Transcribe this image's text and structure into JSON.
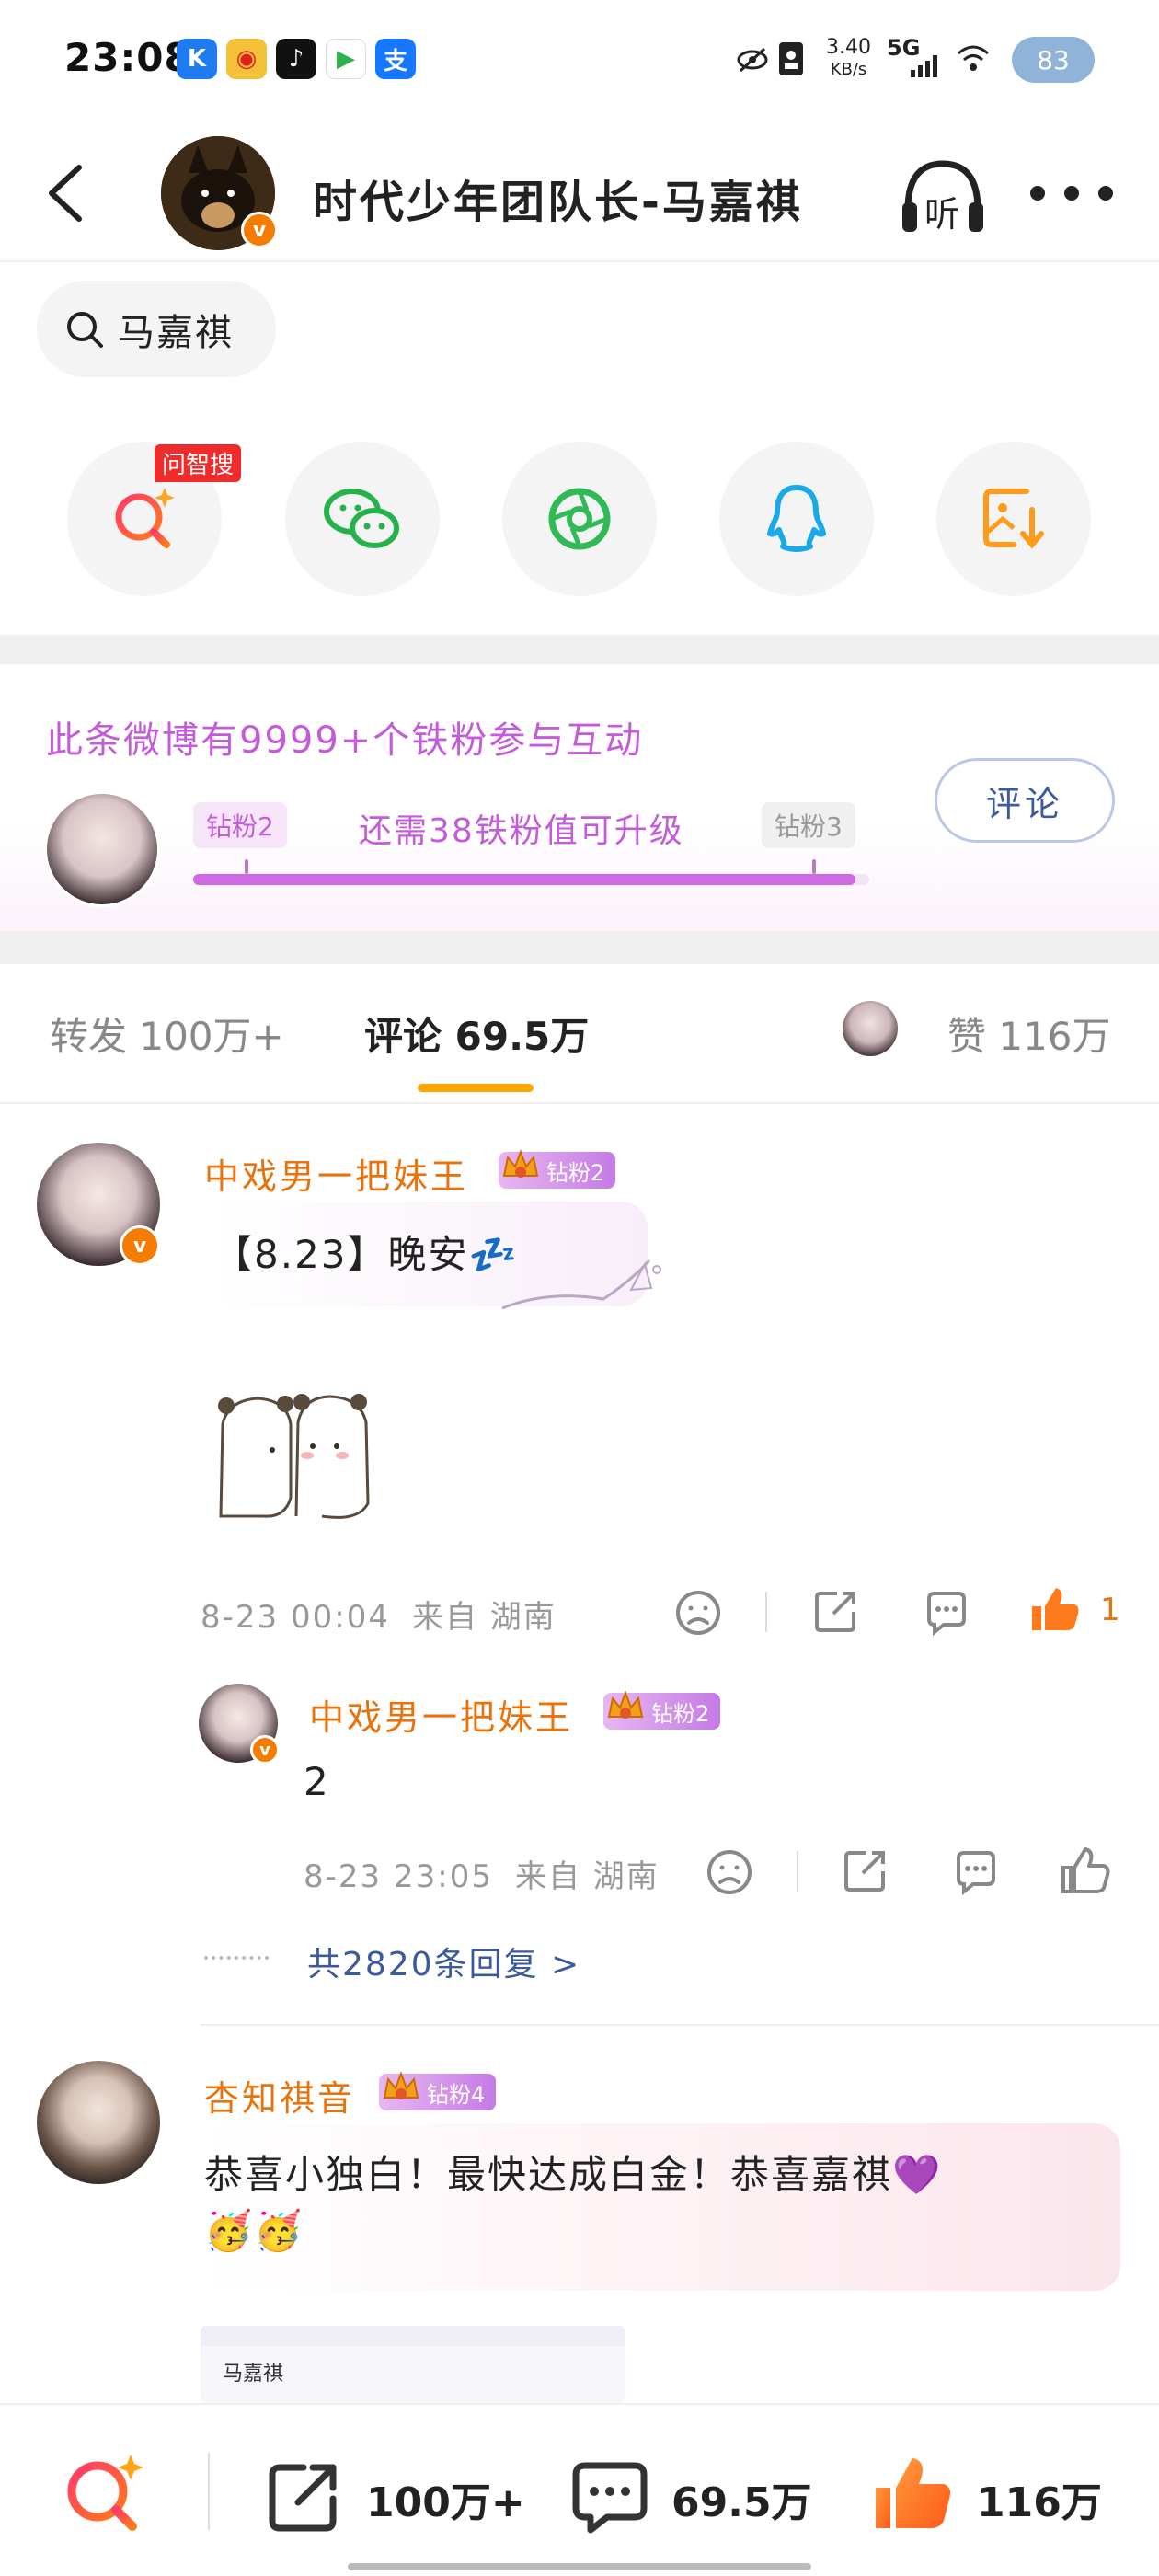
{
  "status_bar": {
    "time": "23:08",
    "net_speed": "3.40",
    "net_unit": "KB/s",
    "signal": "5G",
    "battery": "83"
  },
  "header": {
    "title": "时代少年团队长-马嘉祺",
    "listen_label": "听"
  },
  "search": {
    "query": "马嘉祺"
  },
  "share_row": {
    "ai_tag": "问智搜",
    "items": [
      "ai-search",
      "wechat",
      "moments",
      "qq",
      "save-image"
    ]
  },
  "fan_section": {
    "title": "此条微博有9999+个铁粉参与互动",
    "current_level": "钻粉2",
    "next_level": "钻粉3",
    "progress_text": "还需38铁粉值可升级",
    "progress": 0.98,
    "comment_button": "评论"
  },
  "tabs": {
    "repost": "转发 100万+",
    "comments": "评论 69.5万",
    "likes": "赞 116万"
  },
  "comments": [
    {
      "name": "中戏男一把妹王",
      "badge": "钻粉2",
      "text": "【8.23】晚安💤",
      "time": "8-23 00:04",
      "location": "来自 湖南",
      "likes": "1"
    },
    {
      "name": "中戏男一把妹王",
      "badge": "钻粉2",
      "text": "2",
      "time": "8-23 23:05",
      "location": "来自 湖南",
      "likes": ""
    },
    {
      "name": "杏知祺音",
      "badge": "钻粉4",
      "text_line1": "恭喜小独白！最快达成白金！恭喜嘉祺💜",
      "text_line2": "🥳🥳",
      "preview_label": "马嘉祺"
    }
  ],
  "replies_link": "共2820条回复 >",
  "bottom_bar": {
    "repost_count": "100万+",
    "comment_count": "69.5万",
    "like_count": "116万"
  },
  "colors": {
    "accent_orange": "#e8720b",
    "fan_purple": "#c45bd8",
    "tab_underline": "#ffa500",
    "link_blue": "#3a5a9e"
  }
}
